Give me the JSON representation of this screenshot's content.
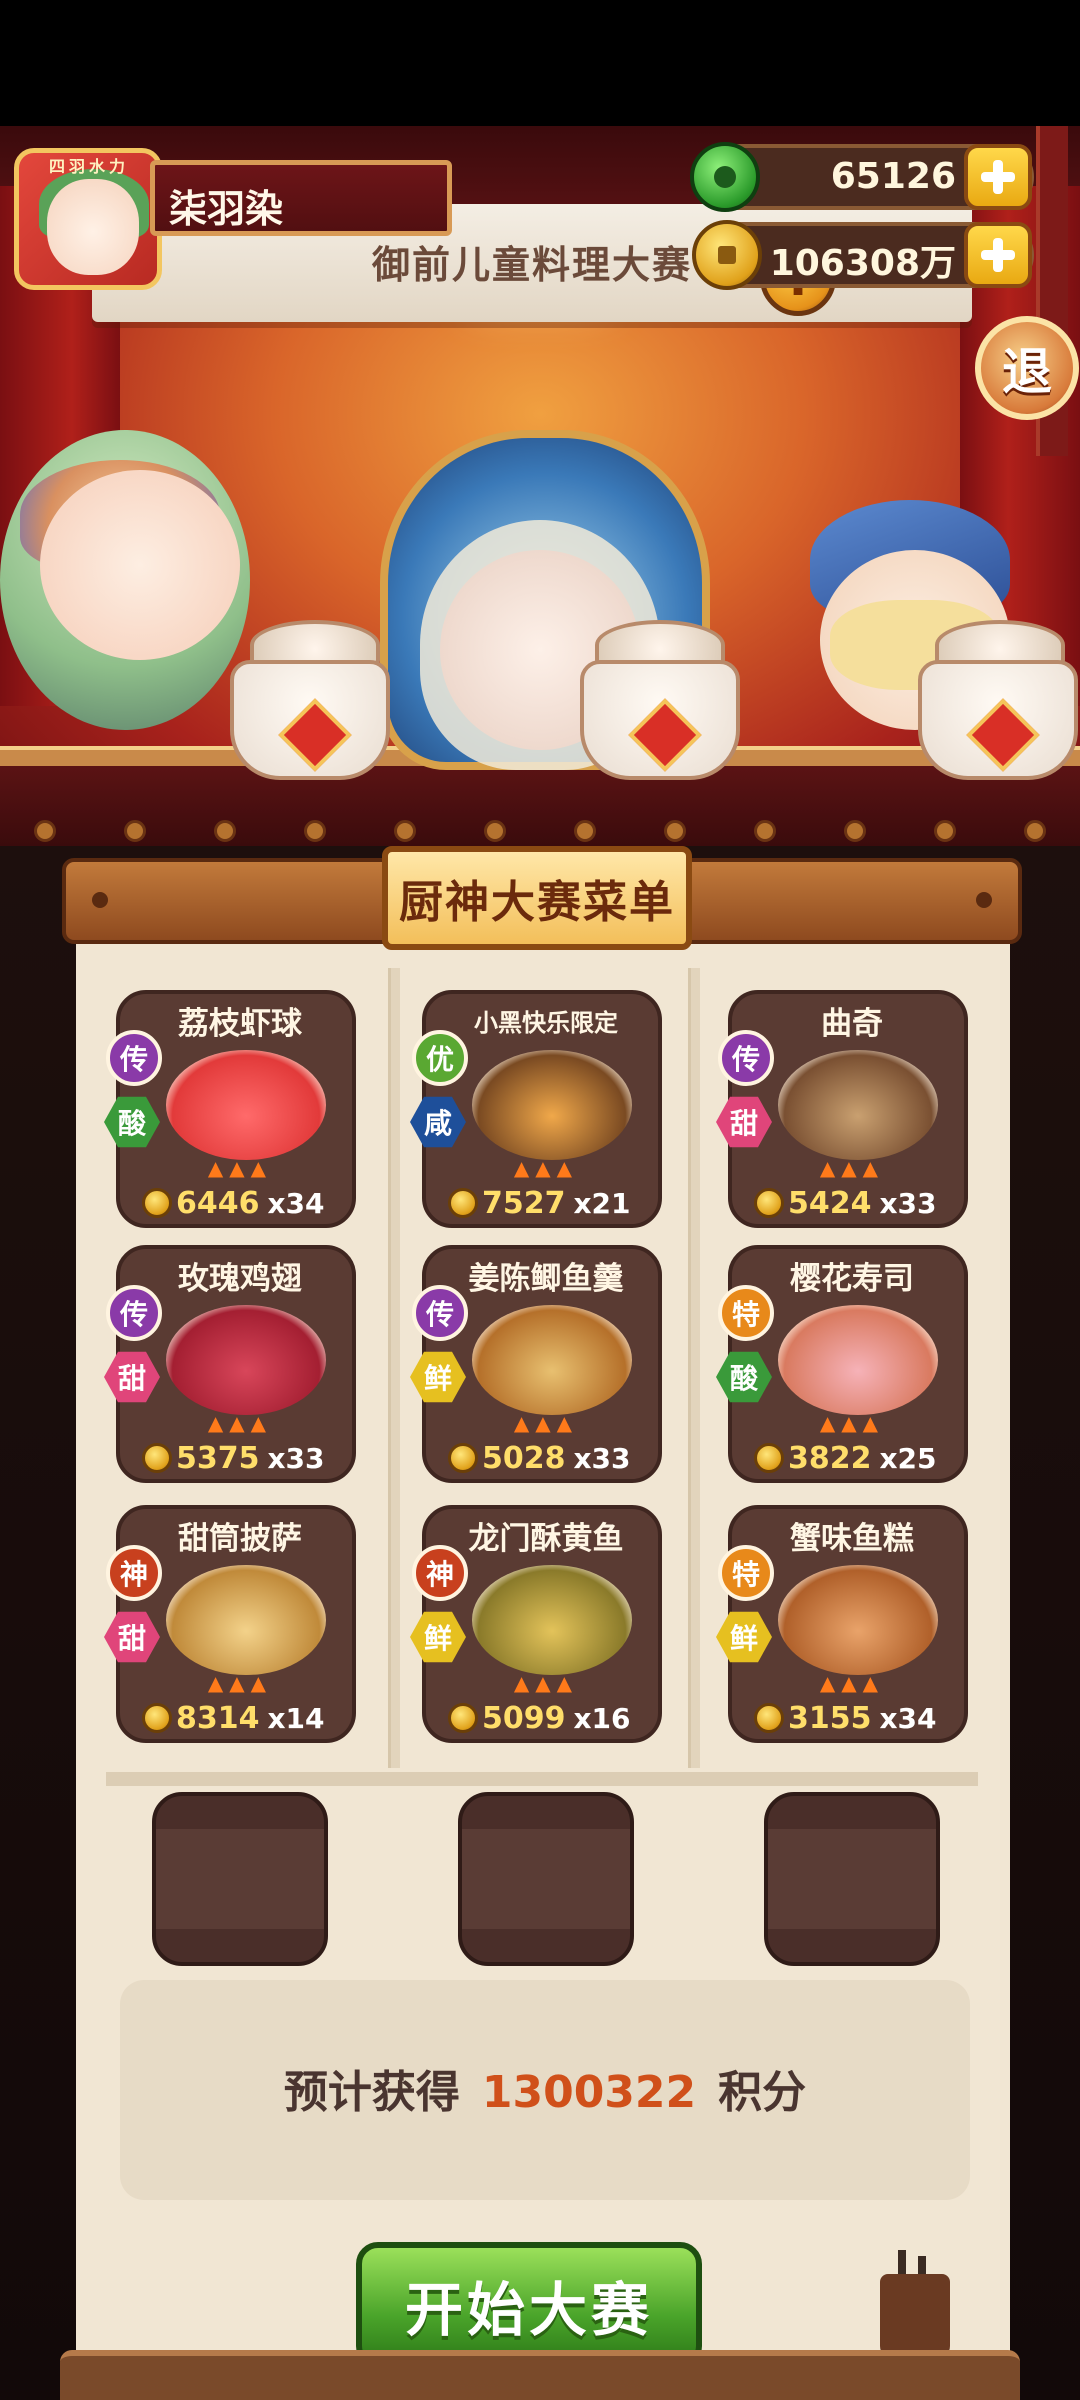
{
  "player": {
    "name": "柒羽染",
    "avatar_tag": "四羽水力"
  },
  "currencies": {
    "jade": {
      "icon": "jade-icon",
      "value": "65126"
    },
    "coin": {
      "icon": "coin-icon",
      "value": "106308万"
    }
  },
  "stage": {
    "banner_title": "御前儿童料理大赛",
    "alert_icon": "exclamation-icon",
    "alert_glyph": "!",
    "exit_label": "退"
  },
  "menu": {
    "title": "厨神大赛菜单",
    "dishes": [
      {
        "name": "荔枝虾球",
        "rank": "传",
        "taste": "酸",
        "price": "6446",
        "qty": "x34"
      },
      {
        "name": "小黑快乐限定",
        "rank": "优",
        "taste": "咸",
        "price": "7527",
        "qty": "x21"
      },
      {
        "name": "曲奇",
        "rank": "传",
        "taste": "甜",
        "price": "5424",
        "qty": "x33"
      },
      {
        "name": "玫瑰鸡翅",
        "rank": "传",
        "taste": "甜",
        "price": "5375",
        "qty": "x33"
      },
      {
        "name": "姜陈鲫鱼羹",
        "rank": "传",
        "taste": "鲜",
        "price": "5028",
        "qty": "x33"
      },
      {
        "name": "樱花寿司",
        "rank": "特",
        "taste": "酸",
        "price": "3822",
        "qty": "x25"
      },
      {
        "name": "甜筒披萨",
        "rank": "神",
        "taste": "甜",
        "price": "8314",
        "qty": "x14"
      },
      {
        "name": "龙门酥黄鱼",
        "rank": "神",
        "taste": "鲜",
        "price": "5099",
        "qty": "x16"
      },
      {
        "name": "蟹味鱼糕",
        "rank": "特",
        "taste": "鲜",
        "price": "3155",
        "qty": "x34"
      }
    ]
  },
  "estimate": {
    "prefix": "预计获得",
    "value": "1300322",
    "suffix": "积分"
  },
  "start_button": {
    "label": "开始大赛"
  },
  "colors": {
    "rank_传": "#8a3aa8",
    "rank_优": "#5aa832",
    "rank_特": "#e8891a",
    "rank_神": "#c8401e",
    "taste_酸": "#3a9a3a",
    "taste_咸": "#1e4f9a",
    "taste_甜": "#e0457a",
    "taste_鲜": "#e6c020",
    "accent_number": "#d0501a"
  }
}
